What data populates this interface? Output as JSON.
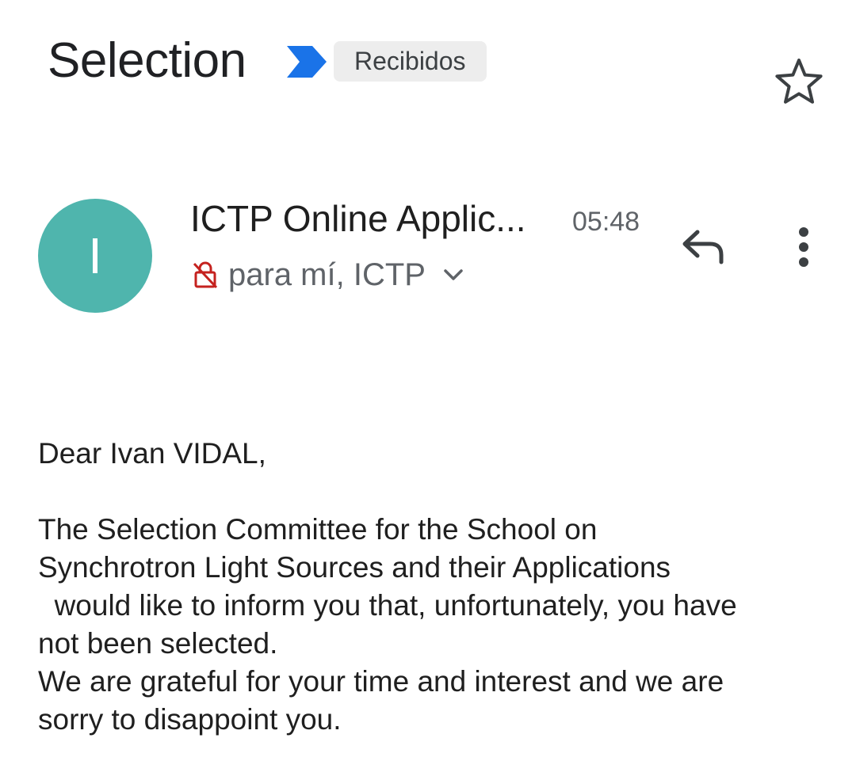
{
  "email": {
    "subject": "Selection",
    "label": "Recibidos",
    "sender": {
      "avatar_letter": "I",
      "name": "ICTP Online Applic...",
      "time": "05:48",
      "recipients": "para mí, ICTP"
    },
    "body": {
      "greeting": "Dear Ivan VIDAL,",
      "lines": [
        "The Selection Committee for the School on",
        "Synchrotron Light Sources and their Applications",
        "  would like to inform you that, unfortunately, you have",
        "not been selected.",
        "We are grateful for your time and interest and we are",
        "sorry to disappoint you."
      ]
    }
  },
  "icons": {
    "importance": "importance-marker-icon",
    "star": "star-icon",
    "lock": "unencrypted-lock-icon",
    "expand": "chevron-down-icon",
    "reply": "reply-icon",
    "more": "more-vert-icon"
  },
  "colors": {
    "avatar": "#4fb5ad",
    "importance": "#1a73e8",
    "lock": "#c5221f",
    "chip_bg": "#ededed"
  }
}
